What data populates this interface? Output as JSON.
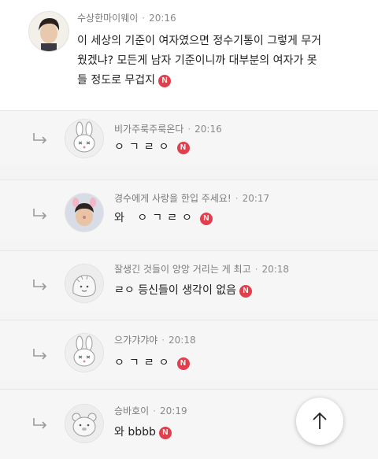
{
  "comments": [
    {
      "nick": "수상한마이웨이",
      "time": "20:16",
      "lines": [
        "이 세상의 기준이 여자였으면 정수기통이 그렇게 무거",
        "웠겠냐? 모든게 남자 기준이니까 대부분의 여자가 못",
        "들 정도로 무겁지"
      ],
      "badge": "N"
    }
  ],
  "replies": [
    {
      "nick": "비가주룩주룩온다",
      "time": "20:16",
      "text": "ㅇㄱㄹㅇ",
      "badge": "N"
    },
    {
      "nick": "경수에게 사랑을 한입 주세요!",
      "time": "20:17",
      "text": "와 ㅇㄱㄹㅇ",
      "badge": "N"
    },
    {
      "nick": "잘생긴 것들이 앙앙 거리는 게 최고",
      "time": "20:18",
      "text": "ㄹㅇ 등신들이 생각이 없음",
      "badge": "N"
    },
    {
      "nick": "으갸갸갸야",
      "time": "20:18",
      "text": "ㅇㄱㄹㅇ",
      "badge": "N"
    },
    {
      "nick": "승바호이",
      "time": "20:19",
      "text": "와 bbbb",
      "badge": "N"
    }
  ],
  "icons": {
    "reply": "reply-arrow-icon",
    "scroll_top": "arrow-up-icon"
  },
  "colors": {
    "badge": "#e0404e",
    "meta": "#8a8a8a"
  }
}
